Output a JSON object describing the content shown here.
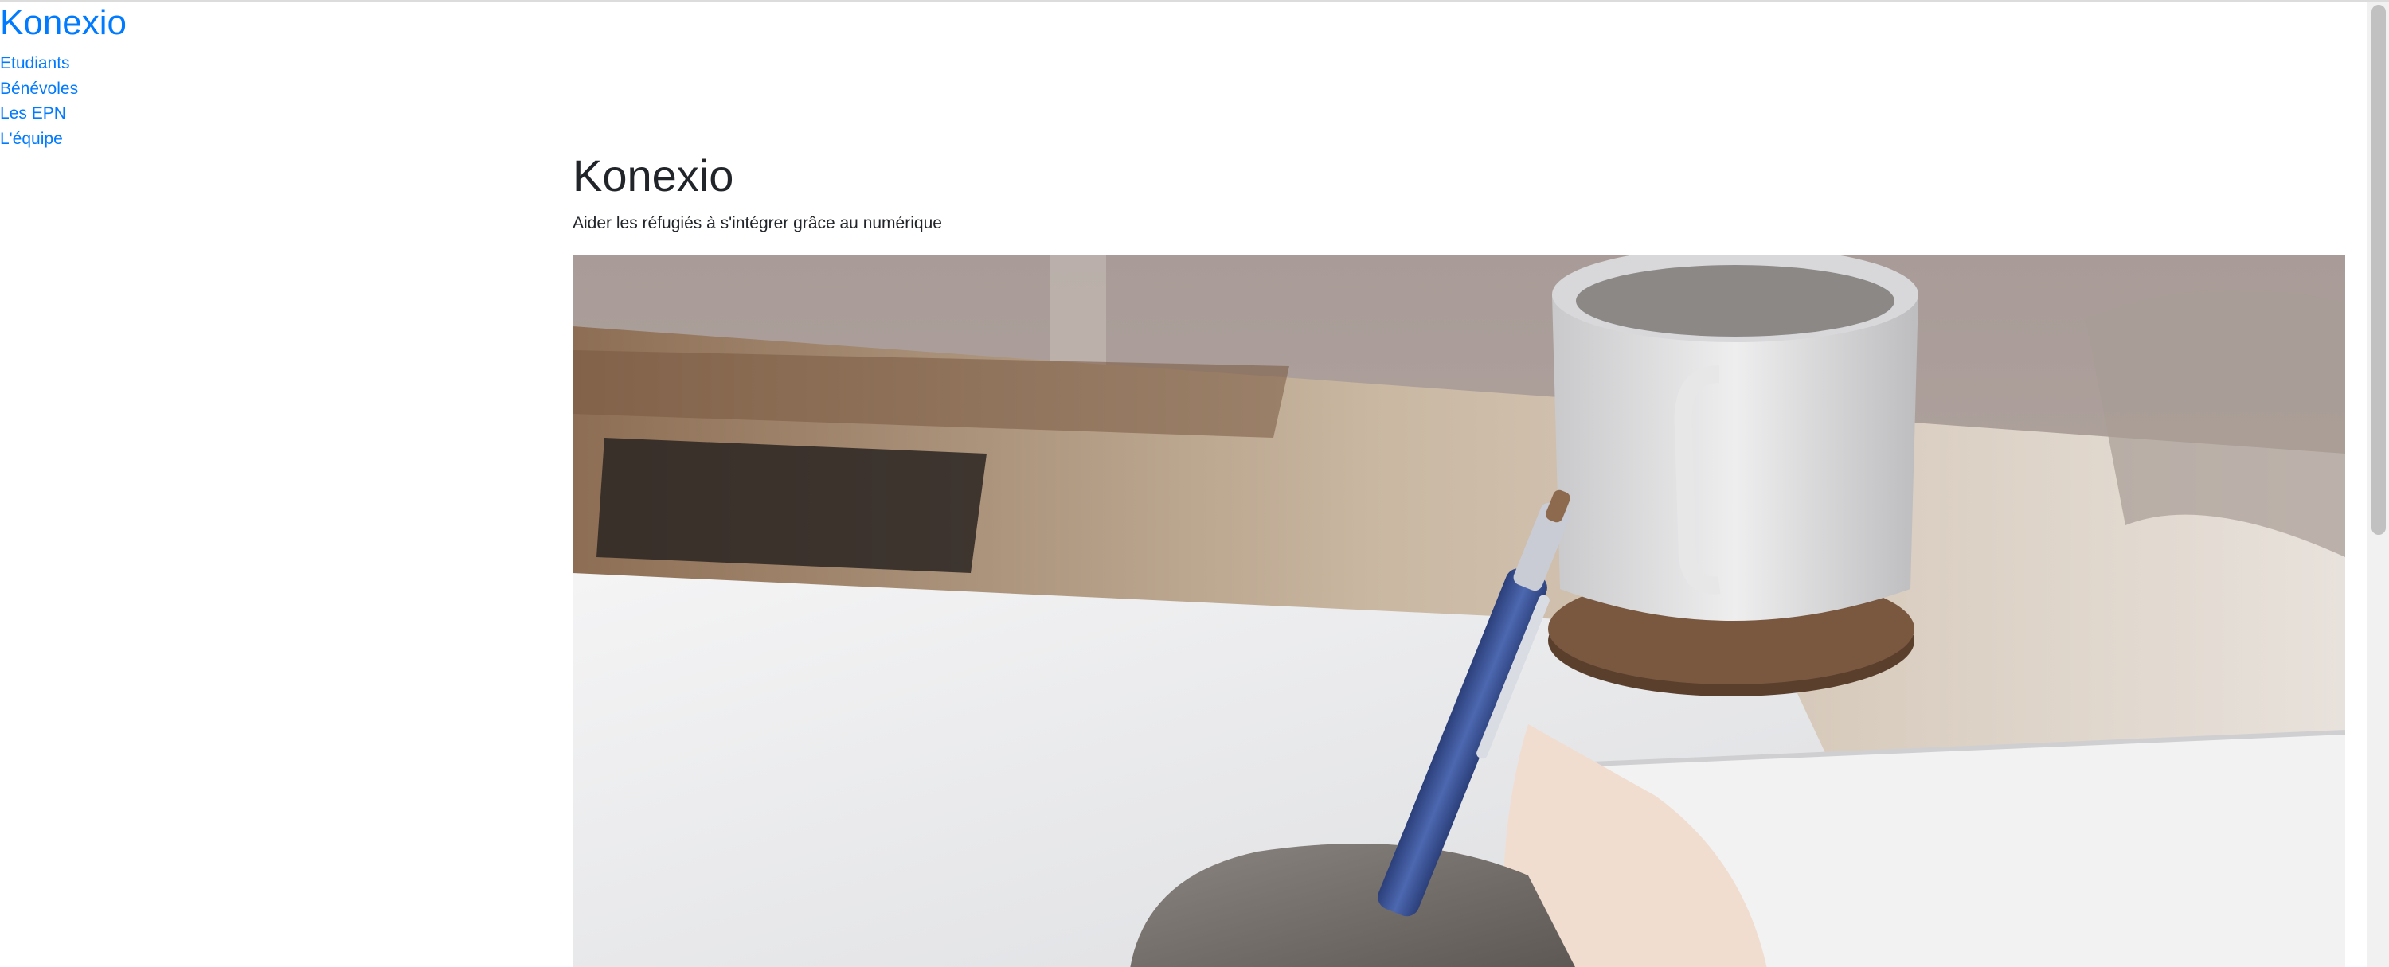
{
  "header": {
    "brand": "Konexio"
  },
  "nav": {
    "items": [
      {
        "label": "Etudiants"
      },
      {
        "label": "Bénévoles"
      },
      {
        "label": "Les EPN"
      },
      {
        "label": "L'équipe"
      }
    ]
  },
  "hero": {
    "title": "Konexio",
    "subtitle": "Aider les réfugiés à s'intégrer grâce au numérique"
  }
}
